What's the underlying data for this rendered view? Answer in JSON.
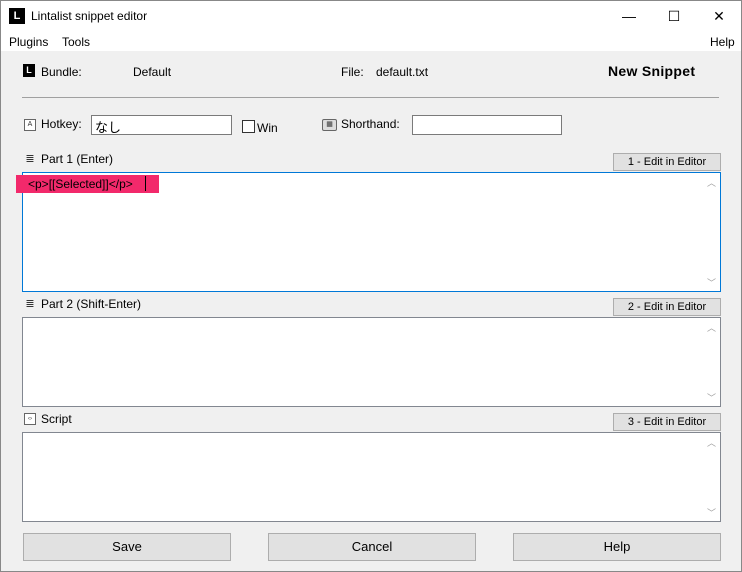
{
  "window": {
    "title": "Lintalist snippet editor",
    "app_icon_letter": "L",
    "minimize_glyph": "—",
    "maximize_glyph": "☐",
    "close_glyph": "✕"
  },
  "menu": {
    "plugins": "Plugins",
    "tools": "Tools",
    "help": "Help"
  },
  "bundle": {
    "label": "Bundle:",
    "value": "Default",
    "icon_letter": "L"
  },
  "file": {
    "label": "File:",
    "value": "default.txt"
  },
  "header_title": "New Snippet",
  "hotkey": {
    "label": "Hotkey:",
    "value": "なし",
    "win_label": "Win",
    "win_checked": false
  },
  "shorthand": {
    "label": "Shorthand:",
    "value": ""
  },
  "part1": {
    "label": "Part 1 (Enter)",
    "edit_button": "1 - Edit in Editor",
    "content": "<p>[[Selected]]</p>"
  },
  "part2": {
    "label": "Part 2 (Shift-Enter)",
    "edit_button": "2 - Edit in Editor",
    "content": ""
  },
  "script": {
    "label": "Script",
    "edit_button": "3 - Edit in Editor",
    "content": ""
  },
  "buttons": {
    "save": "Save",
    "cancel": "Cancel",
    "help": "Help"
  },
  "scroll_arrows": {
    "up": "︿",
    "down": "﹀"
  }
}
